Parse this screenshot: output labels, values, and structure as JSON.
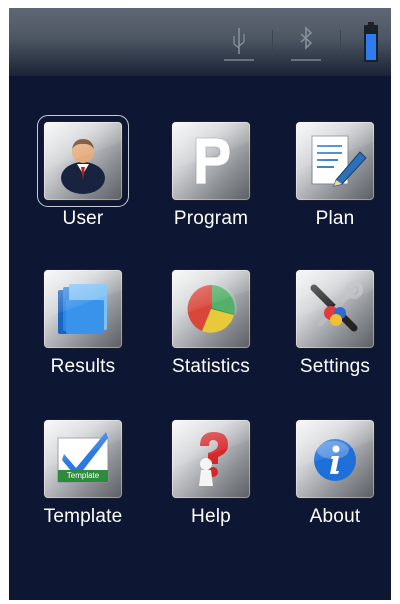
{
  "status_bar": {
    "icons": [
      "usb-icon",
      "bluetooth-icon",
      "battery-icon"
    ]
  },
  "menu": {
    "tiles": [
      {
        "label": "User",
        "icon": "user-icon",
        "selected": true
      },
      {
        "label": "Program",
        "icon": "program-p-icon"
      },
      {
        "label": "Plan",
        "icon": "plan-document-pencil-icon"
      },
      {
        "label": "Results",
        "icon": "results-folder-icon"
      },
      {
        "label": "Statistics",
        "icon": "statistics-pie-icon"
      },
      {
        "label": "Settings",
        "icon": "settings-tools-icon"
      },
      {
        "label": "Template",
        "icon": "template-check-icon",
        "badge": "Template"
      },
      {
        "label": "Help",
        "icon": "help-question-icon"
      },
      {
        "label": "About",
        "icon": "about-info-icon"
      }
    ]
  },
  "colors": {
    "background": "#0d1733",
    "label": "#ffffff",
    "battery": "#2f7cf0",
    "check": "#2a79e6",
    "info": "#1f6fd8"
  }
}
